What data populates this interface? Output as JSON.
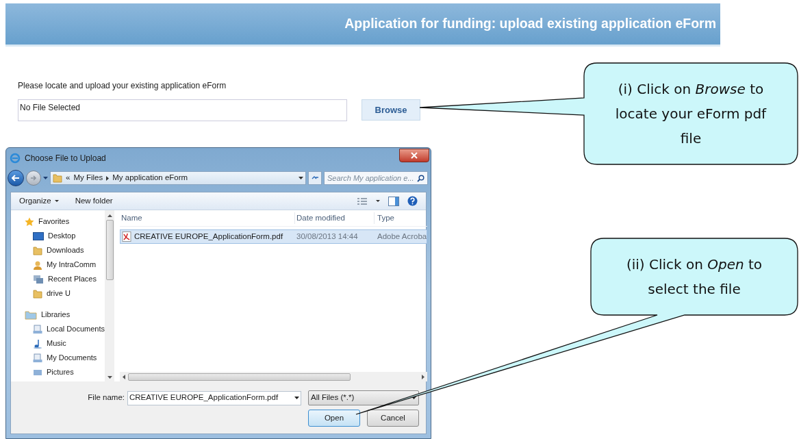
{
  "header": {
    "title": "Application for funding: upload existing application eForm"
  },
  "upload": {
    "instruction": "Please locate and upload your existing application eForm",
    "file_field": {
      "value": "No File Selected"
    },
    "browse_button": "Browse"
  },
  "dialog": {
    "title": "Choose File to Upload",
    "breadcrumb_prefix": "«",
    "breadcrumb": [
      {
        "label": "My Files"
      },
      {
        "label": "My application eForm"
      }
    ],
    "search": {
      "placeholder": "Search My application e..."
    },
    "toolbar": [
      {
        "label": "Organize",
        "kind": "menu"
      },
      {
        "label": "New folder",
        "kind": "button"
      }
    ],
    "nav": [
      {
        "label": "Favorites",
        "kind": "star",
        "children": [
          {
            "label": "Desktop",
            "kind": "desktop"
          },
          {
            "label": "Downloads",
            "kind": "folder"
          },
          {
            "label": "My IntraComm",
            "kind": "user"
          },
          {
            "label": "Recent Places",
            "kind": "places"
          },
          {
            "label": "drive U",
            "kind": "folder"
          }
        ]
      },
      {
        "label": "Libraries",
        "kind": "library",
        "children": [
          {
            "label": "Local Documents",
            "kind": "document"
          },
          {
            "label": "Music",
            "kind": "music"
          },
          {
            "label": "My Documents",
            "kind": "document"
          },
          {
            "label": "Pictures",
            "kind": "picture"
          }
        ]
      }
    ],
    "columns": [
      "Name",
      "Date modified",
      "Type"
    ],
    "files": [
      {
        "name": "CREATIVE EUROPE_ApplicationForm.pdf",
        "date": "30/08/2013 14:44",
        "type": "Adobe Acroba",
        "selected": true
      }
    ],
    "file_name_label": "File name:",
    "file_name": "CREATIVE EUROPE_ApplicationForm.pdf",
    "filter": "All Files (*.*)",
    "buttons": [
      {
        "label": "Open",
        "kind": "default"
      },
      {
        "label": "Cancel",
        "kind": "normal"
      }
    ]
  },
  "callouts": [
    {
      "text": "(i) Click on *Browse* to locate your eForm pdf file"
    },
    {
      "text": "(ii) Click on *Open* to select the file"
    }
  ]
}
